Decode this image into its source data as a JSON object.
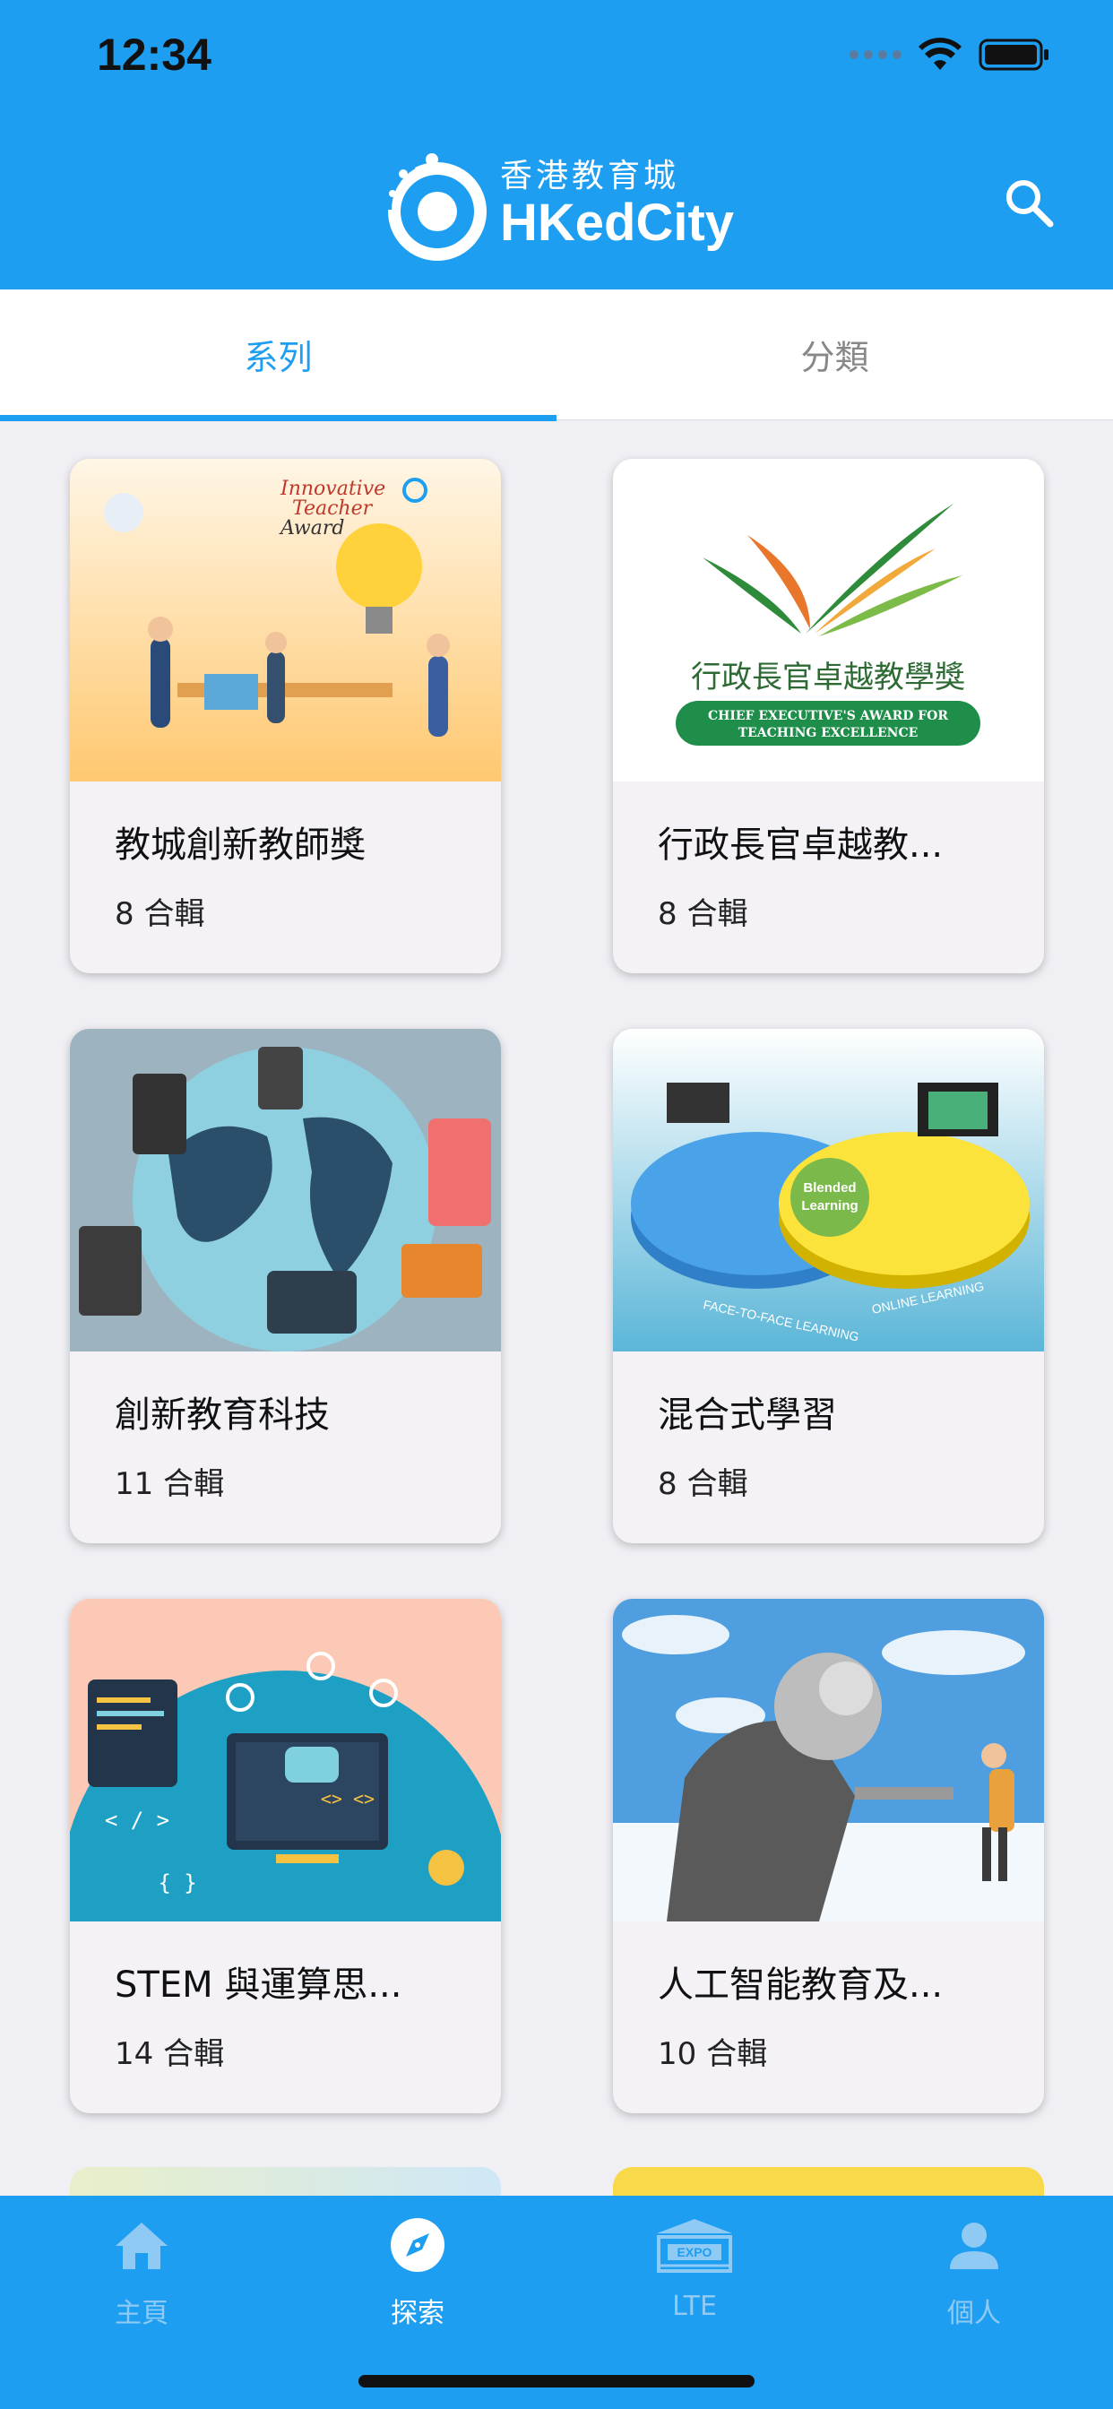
{
  "status_bar": {
    "time": "12:34"
  },
  "header": {
    "logo_cn": "香港教育城",
    "logo_en": "HKedCity"
  },
  "tabs": [
    {
      "label": "系列",
      "active": true
    },
    {
      "label": "分類",
      "active": false
    }
  ],
  "cards": [
    {
      "title": "教城創新教師獎",
      "count": "8 合輯",
      "image_text": [
        "Innovative",
        "Teacher",
        "Award"
      ]
    },
    {
      "title": "行政長官卓越教...",
      "count": "8 合輯",
      "image_text": [
        "行政長官卓越教學獎",
        "CHIEF EXECUTIVE'S AWARD FOR",
        "TEACHING EXCELLENCE"
      ]
    },
    {
      "title": "創新教育科技",
      "count": "11 合輯"
    },
    {
      "title": "混合式學習",
      "count": "8 合輯",
      "image_text": [
        "Blended",
        "Learning",
        "FACE-TO-FACE LEARNING",
        "ONLINE LEARNING"
      ]
    },
    {
      "title": "STEM 與運算思...",
      "count": "14 合輯",
      "image_text": [
        "< / >",
        "{ }",
        "<> <>"
      ]
    },
    {
      "title": "人工智能教育及...",
      "count": "10 合輯"
    }
  ],
  "bottom_nav": [
    {
      "label": "主頁",
      "icon": "home-icon",
      "active": false
    },
    {
      "label": "探索",
      "icon": "compass-icon",
      "active": true
    },
    {
      "label": "LTE",
      "icon": "expo-icon",
      "active": false,
      "icon_text": "EXPO"
    },
    {
      "label": "個人",
      "icon": "person-icon",
      "active": false
    }
  ],
  "colors": {
    "primary": "#1e9ef0",
    "card_bg": "#f4f2f7",
    "page_bg": "#efeff4"
  }
}
